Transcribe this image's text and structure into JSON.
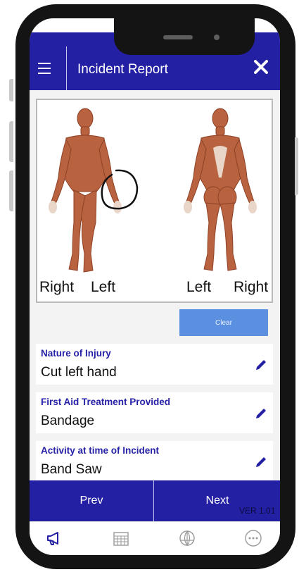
{
  "header": {
    "title": "Incident Report"
  },
  "body_chart": {
    "front_labels": [
      "Right",
      "Left"
    ],
    "back_labels": [
      "Left",
      "Right"
    ],
    "clear_label": "Clear"
  },
  "fields": [
    {
      "label": "Nature of Injury",
      "value": "Cut left hand"
    },
    {
      "label": "First Aid Treatment Provided",
      "value": "Bandage"
    },
    {
      "label": "Activity at time of Incident",
      "value": "Band Saw"
    }
  ],
  "nav": {
    "prev_label": "Prev",
    "next_label": "Next",
    "version": "VER 1.01"
  },
  "tabs": [
    "megaphone-icon",
    "calendar-icon",
    "globe-icon",
    "more-icon"
  ],
  "colors": {
    "brand": "#2420a4",
    "accent_button": "#5b8fdf",
    "field_label": "#2621a6",
    "tab_active": "#2420a4",
    "tab_inactive": "#9a9a9a"
  }
}
